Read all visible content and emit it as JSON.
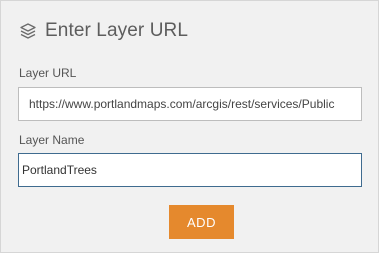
{
  "header": {
    "icon": "layers-icon",
    "title": "Enter Layer URL"
  },
  "form": {
    "url_label": "Layer URL",
    "url_value": "https://www.portlandmaps.com/arcgis/rest/services/Public",
    "name_label": "Layer Name",
    "name_value": "PortlandTrees"
  },
  "actions": {
    "add_label": "ADD"
  },
  "colors": {
    "panel_bg": "#f1f1f1",
    "accent_button": "#e5892d",
    "focus_border": "#3f6b8f"
  }
}
